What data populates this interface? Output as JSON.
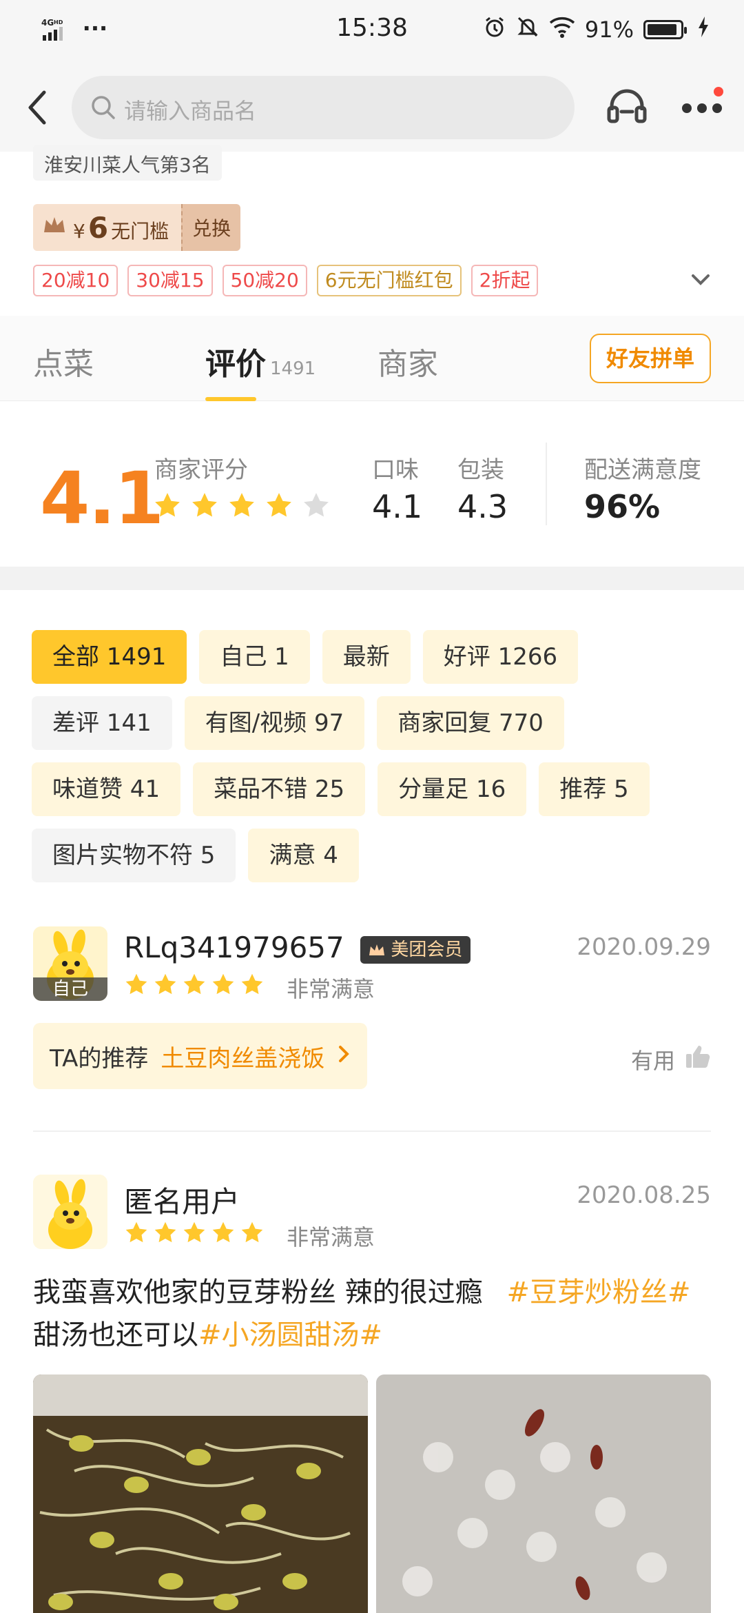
{
  "status_bar": {
    "network": "4G HD",
    "more": "···",
    "time": "15:38",
    "battery": "91%",
    "battery_level": 0.91
  },
  "header": {
    "search_placeholder": "请输入商品名"
  },
  "store": {
    "rank_text": "淮安川菜人气第3名",
    "coupon": {
      "currency": "¥",
      "amount": "6",
      "label": "无门槛",
      "action": "兑换"
    },
    "discounts": [
      "20减10",
      "30减15",
      "50减20",
      "6元无门槛红包",
      "2折起"
    ]
  },
  "tabs": {
    "items": [
      {
        "label": "点菜"
      },
      {
        "label": "评价",
        "count": "1491"
      },
      {
        "label": "商家"
      }
    ],
    "group_order": "好友拼单"
  },
  "ratings": {
    "overall": "4.1",
    "overall_label": "商家评分",
    "overall_stars": 4,
    "taste_label": "口味",
    "taste": "4.1",
    "package_label": "包装",
    "package": "4.3",
    "delivery_label": "配送满意度",
    "delivery": "96%"
  },
  "filters": {
    "rows": [
      [
        "全部 1491",
        "自己 1",
        "最新",
        "好评 1266"
      ],
      [
        "差评 141",
        "有图/视频 97",
        "商家回复 770"
      ],
      [
        "味道赞 41",
        "菜品不错 25",
        "分量足 16",
        "推荐 5"
      ],
      [
        "图片实物不符 5",
        "满意 4"
      ]
    ]
  },
  "reviews": [
    {
      "user": "RLq341979657",
      "badge": "美团会员",
      "avatar_tag": "自己",
      "date": "2020.09.29",
      "stars": 5,
      "level": "非常满意",
      "recommend_label": "TA的推荐",
      "recommend_dish": "土豆肉丝盖浇饭",
      "useful": "有用"
    },
    {
      "user": "匿名用户",
      "date": "2020.08.25",
      "stars": 5,
      "level": "非常满意",
      "text_a": "我蛮喜欢他家的豆芽粉丝 辣的很过瘾",
      "hash_a": "#豆芽炒粉丝#",
      "text_b": "甜汤也还可以",
      "hash_b": "#小汤圆甜汤#"
    }
  ],
  "colors": {
    "accent": "#ffc72c",
    "score": "#f58220",
    "tag_red": "#ee4a4a",
    "hash": "#f5a623"
  }
}
